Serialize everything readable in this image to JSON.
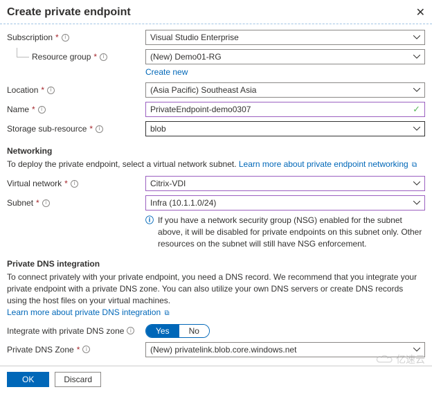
{
  "header": {
    "title": "Create private endpoint"
  },
  "labels": {
    "subscription": "Subscription",
    "resource_group": "Resource group",
    "location": "Location",
    "name": "Name",
    "storage_sub": "Storage sub-resource",
    "virtual_network": "Virtual network",
    "subnet": "Subnet",
    "integrate_dns": "Integrate with private DNS zone",
    "private_dns_zone": "Private DNS Zone"
  },
  "values": {
    "subscription": "Visual Studio Enterprise",
    "resource_group": "(New) Demo01-RG",
    "location": "(Asia Pacific) Southeast Asia",
    "name": "PrivateEndpoint-demo0307",
    "storage_sub": "blob",
    "virtual_network": "Citrix-VDI",
    "subnet": "Infra (10.1.1.0/24)",
    "private_dns_zone": "(New) privatelink.blob.core.windows.net"
  },
  "links": {
    "create_new": "Create new",
    "learn_networking": "Learn more about private endpoint networking",
    "learn_dns": "Learn more about private DNS integration"
  },
  "sections": {
    "networking": "Networking",
    "networking_desc": "To deploy the private endpoint, select a virtual network subnet. ",
    "nsg_note": "If you have a network security group (NSG) enabled for the subnet above, it will be disabled for private endpoints on this subnet only. Other resources on the subnet will still have NSG enforcement.",
    "dns": "Private DNS integration",
    "dns_desc": "To connect privately with your private endpoint, you need a DNS record. We recommend that you integrate your private endpoint with a private DNS zone. You can also utilize your own DNS servers or create DNS records using the host files on your virtual machines."
  },
  "toggle": {
    "yes": "Yes",
    "no": "No"
  },
  "footer": {
    "ok": "OK",
    "discard": "Discard"
  },
  "watermark": "亿速云"
}
